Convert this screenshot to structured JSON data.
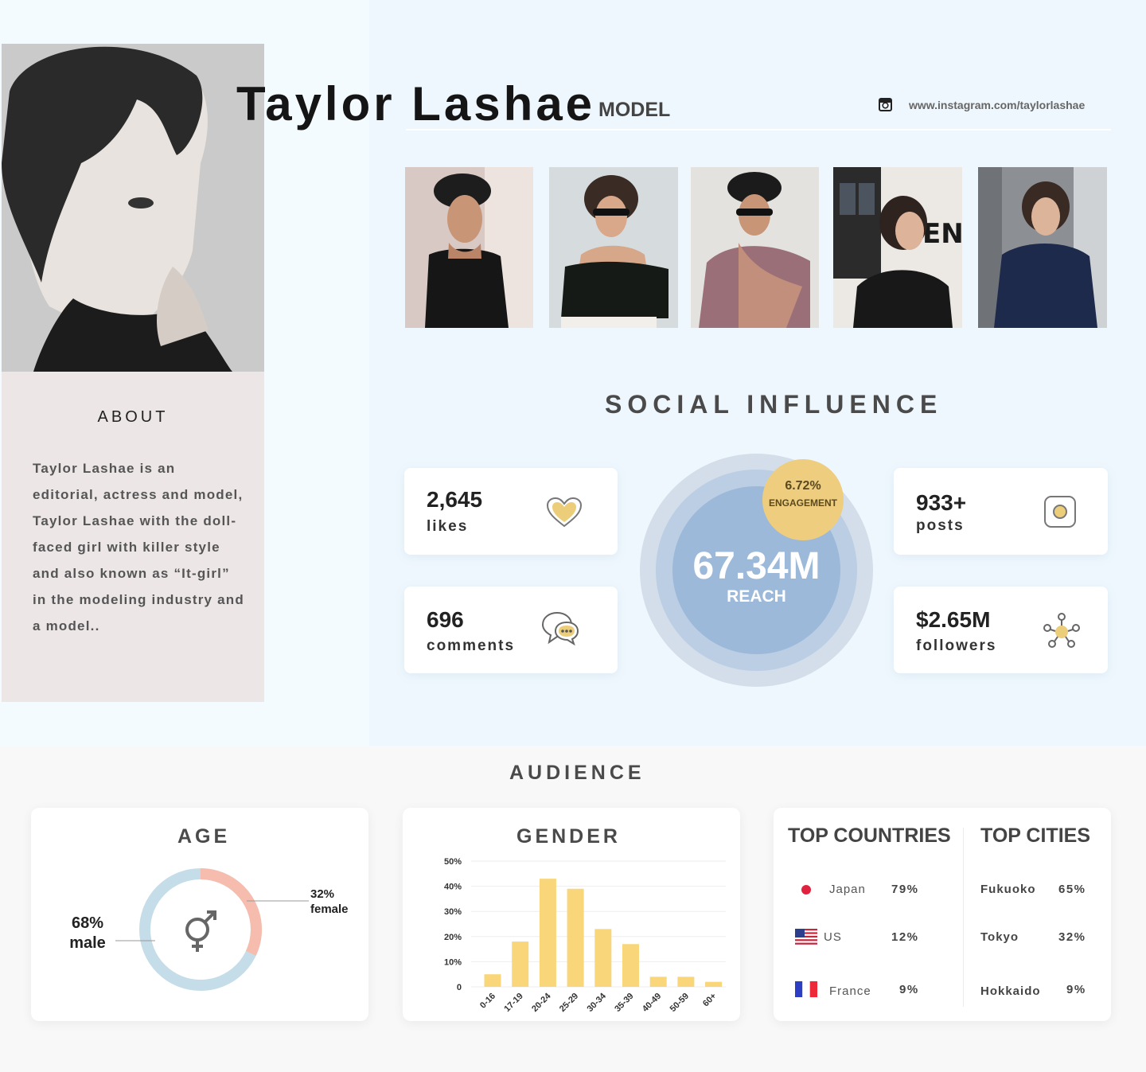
{
  "profile": {
    "name": "Taylor Lashae",
    "role": "MODEL",
    "instagram_url": "www.instagram.com/taylorlashae"
  },
  "about": {
    "title": "ABOUT",
    "lines": [
      "Taylor Lashae is an",
      "editorial, actress and model,",
      "Taylor Lashae with the doll-",
      "faced girl with killer style",
      "and also known as “It-girl”",
      "in the modeling industry and",
      "a model.."
    ]
  },
  "social": {
    "title": "SOCIAL INFLUENCE",
    "likes": {
      "value": "2,645",
      "label": "likes"
    },
    "comments": {
      "value": "696",
      "label": "comments"
    },
    "posts": {
      "value": "933+",
      "label": "posts"
    },
    "followers": {
      "value": "$2.65M",
      "label": "followers"
    },
    "reach": {
      "value": "67.34M",
      "label": "REACH"
    },
    "engagement": {
      "value": "6.72%",
      "label": "ENGAGEMENT"
    }
  },
  "audience": {
    "title": "AUDIENCE",
    "age": {
      "title": "AGE",
      "male_pct": "68%",
      "male_label": "male",
      "female_pct": "32%",
      "female_label": "female",
      "male_share": 0.68,
      "female_share": 0.32
    },
    "gender": {
      "title": "GENDER"
    },
    "countries": {
      "title": "TOP COUNTRIES",
      "items": [
        {
          "name": "Japan",
          "pct": "79%"
        },
        {
          "name": "US",
          "pct": "12%"
        },
        {
          "name": "France",
          "pct": "9%"
        }
      ]
    },
    "cities": {
      "title": "TOP CITIES",
      "items": [
        {
          "name": "Fukuoko",
          "pct": "65%"
        },
        {
          "name": "Tokyo",
          "pct": "32%"
        },
        {
          "name": "Hokkaido",
          "pct": "9%"
        }
      ]
    }
  },
  "colors": {
    "reach_core": "#9cb9da",
    "engagement": "#eecd7f",
    "bar": "#f8d679",
    "male": "#c5dde8",
    "female": "#f6bcae",
    "about_bg": "#ece6e6"
  },
  "chart_data": {
    "type": "bar",
    "categories": [
      "0-16",
      "17-19",
      "20-24",
      "25-29",
      "30-34",
      "35-39",
      "40-49",
      "50-59",
      "60+"
    ],
    "values": [
      5,
      18,
      43,
      39,
      23,
      17,
      4,
      4,
      2
    ],
    "y_ticks": [
      "0",
      "10%",
      "20%",
      "30%",
      "40%",
      "50%"
    ],
    "ylim": [
      0,
      50
    ],
    "grid": true,
    "xlabel": "",
    "ylabel": ""
  }
}
